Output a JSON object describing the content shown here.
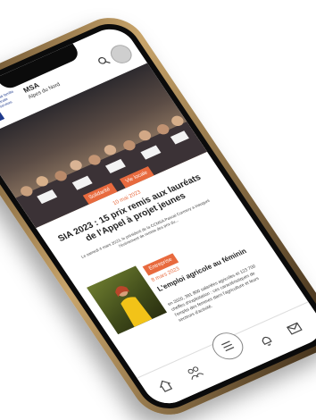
{
  "header": {
    "logo_top": "m",
    "logo_bottom": "sa",
    "logo_tagline": "santé famille retraite services",
    "brand": "MSA",
    "region": "Alpes du Nord"
  },
  "hero": {
    "tags": [
      "Solidarité",
      "Vie locale"
    ],
    "date": "10 mai 2023",
    "title": "SIA 2023 : 15 prix remis aux lauréats de l'Appel à projet jeunes",
    "description": "Le samedi 4 mars 2023, le président de la CCMSA Pascal Cormery a inauguré l'événement de remise des prix du..."
  },
  "article2": {
    "tag": "Entreprise",
    "date": "8 mars 2023",
    "title": "L'emploi agricole au féminin",
    "description": "en 2020, 381 800 salariées agricoles et 123 700 cheffes d'exploitation : ces caractéristiques de l'emploi des femmes dans l'agriculture et leurs secteurs d'activité."
  },
  "bottom_nav": {
    "icons": [
      "home-icon",
      "people-icon",
      "menu-icon",
      "notifications-icon",
      "mail-icon"
    ]
  },
  "colors": {
    "accent": "#e86a3e",
    "brand": "#1e3a8c"
  }
}
